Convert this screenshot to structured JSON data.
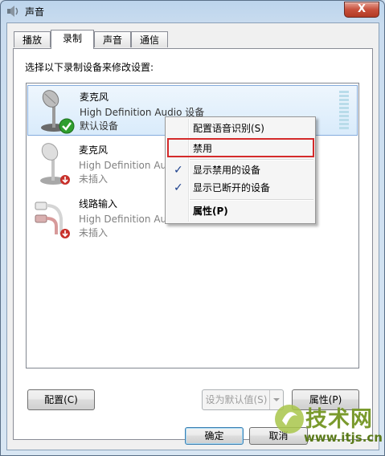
{
  "window": {
    "title": "声音",
    "close_label": "X"
  },
  "tabs": [
    {
      "label": "播放"
    },
    {
      "label": "录制"
    },
    {
      "label": "声音"
    },
    {
      "label": "通信"
    }
  ],
  "instruction": "选择以下录制设备来修改设置:",
  "devices": [
    {
      "name": "麦克风",
      "description": "High Definition Audio 设备",
      "status": "默认设备"
    },
    {
      "name": "麦克风",
      "description": "High Definition Audio 设备",
      "status": "未插入"
    },
    {
      "name": "线路输入",
      "description": "High Definition Audio 设备",
      "status": "未插入"
    }
  ],
  "context_menu": {
    "items": [
      {
        "label": "配置语音识别(S)"
      },
      {
        "label": "禁用"
      },
      {
        "label": "显示禁用的设备"
      },
      {
        "label": "显示已断开的设备"
      },
      {
        "label": "属性(P)"
      }
    ]
  },
  "buttons": {
    "configure": "配置(C)",
    "set_default": "设为默认值(S)",
    "properties": "属性(P)",
    "ok": "确定",
    "cancel": "取消"
  },
  "watermark": {
    "title": "技术网",
    "url": "www.itjs.cn"
  },
  "colors": {
    "highlight_border": "#d42a2a",
    "check_color": "#1b3f8c",
    "selected_bg": "#d9ebfb"
  },
  "icons": [
    "speaker-icon",
    "microphone-icon",
    "line-in-icon",
    "checkmark-icon",
    "disconnected-icon"
  ]
}
